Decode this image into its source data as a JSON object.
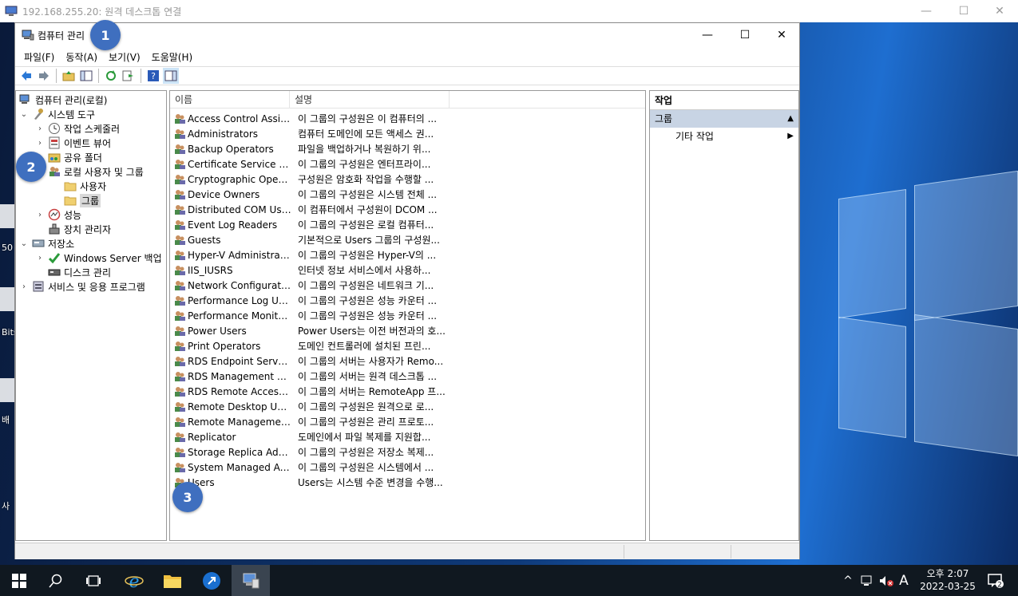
{
  "rdp": {
    "title": "192.168.255.20: 원격 데스크톱 연결",
    "minimize": "—",
    "maximize": "☐",
    "close": "✕"
  },
  "desktop": {
    "label_fragments": [
      "50",
      "Bits",
      "배",
      "사"
    ]
  },
  "window": {
    "title": "컴퓨터 관리",
    "minimize": "—",
    "maximize": "☐",
    "close": "✕"
  },
  "menu": [
    "파일(F)",
    "동작(A)",
    "보기(V)",
    "도움말(H)"
  ],
  "tree": {
    "root": "컴퓨터 관리(로컬)",
    "system_tools": "시스템 도구",
    "task_scheduler": "작업 스케줄러",
    "event_viewer": "이벤트 뷰어",
    "shared_folders": "공유 폴더",
    "local_users_groups": "로컬 사용자 및 그룹",
    "users": "사용자",
    "groups": "그룹",
    "performance": "성능",
    "device_manager": "장치 관리자",
    "storage": "저장소",
    "windows_backup": "Windows Server 백업",
    "disk_management": "디스크 관리",
    "services_apps": "서비스 및 응용 프로그램"
  },
  "list": {
    "col_name": "이름",
    "col_desc": "설명",
    "rows": [
      {
        "name": "Access Control Assist...",
        "desc": "이 그룹의 구성원은 이 컴퓨터의 ..."
      },
      {
        "name": "Administrators",
        "desc": "컴퓨터 도메인에 모든 액세스 권..."
      },
      {
        "name": "Backup Operators",
        "desc": "파일을 백업하거나 복원하기 위..."
      },
      {
        "name": "Certificate Service DC...",
        "desc": "이 그룹의 구성원은 엔터프라이..."
      },
      {
        "name": "Cryptographic Operat...",
        "desc": "구성원은 암호화 작업을 수행할 ..."
      },
      {
        "name": "Device Owners",
        "desc": "이 그룹의 구성원은 시스템 전체 ..."
      },
      {
        "name": "Distributed COM Users",
        "desc": "이 컴퓨터에서 구성원이 DCOM ..."
      },
      {
        "name": "Event Log Readers",
        "desc": "이 그룹의 구성원은 로컬 컴퓨터..."
      },
      {
        "name": "Guests",
        "desc": "기본적으로 Users 그룹의 구성원..."
      },
      {
        "name": "Hyper-V Administrat...",
        "desc": "이 그룹의 구성원은 Hyper-V의 ..."
      },
      {
        "name": "IIS_IUSRS",
        "desc": "인터넷 정보 서비스에서 사용하..."
      },
      {
        "name": "Network Configuratio...",
        "desc": "이 그룹의 구성원은 네트워크 기..."
      },
      {
        "name": "Performance Log Users",
        "desc": "이 그룹의 구성원은 성능 카운터 ..."
      },
      {
        "name": "Performance Monitor...",
        "desc": "이 그룹의 구성원은 성능 카운터 ..."
      },
      {
        "name": "Power Users",
        "desc": "Power Users는 이전 버전과의 호..."
      },
      {
        "name": "Print Operators",
        "desc": "도메인 컨트롤러에 설치된 프린..."
      },
      {
        "name": "RDS Endpoint Servers",
        "desc": "이 그룹의 서버는 사용자가 Remo..."
      },
      {
        "name": "RDS Management Se...",
        "desc": "이 그룹의 서버는 원격 데스크톱 ..."
      },
      {
        "name": "RDS Remote Access ...",
        "desc": "이 그룹의 서버는 RemoteApp 프..."
      },
      {
        "name": "Remote Desktop Users",
        "desc": "이 그룹의 구성원은 원격으로 로..."
      },
      {
        "name": "Remote Management...",
        "desc": "이 그룹의 구성원은 관리 프로토..."
      },
      {
        "name": "Replicator",
        "desc": "도메인에서 파일 복제를 지원합..."
      },
      {
        "name": "Storage Replica Admi...",
        "desc": "이 그룹의 구성원은 저장소 복제..."
      },
      {
        "name": "System Managed Acc...",
        "desc": "이 그룹의 구성원은 시스템에서 ..."
      },
      {
        "name": "Users",
        "desc": "Users는 시스템 수준 변경을 수행..."
      }
    ]
  },
  "actions": {
    "header": "작업",
    "group": "그룹",
    "more": "기타 작업"
  },
  "badges": [
    "1",
    "2",
    "3"
  ],
  "taskbar": {
    "clock_time": "오후 2:07",
    "clock_date": "2022-03-25",
    "ime": "A",
    "notification_count": "2"
  }
}
